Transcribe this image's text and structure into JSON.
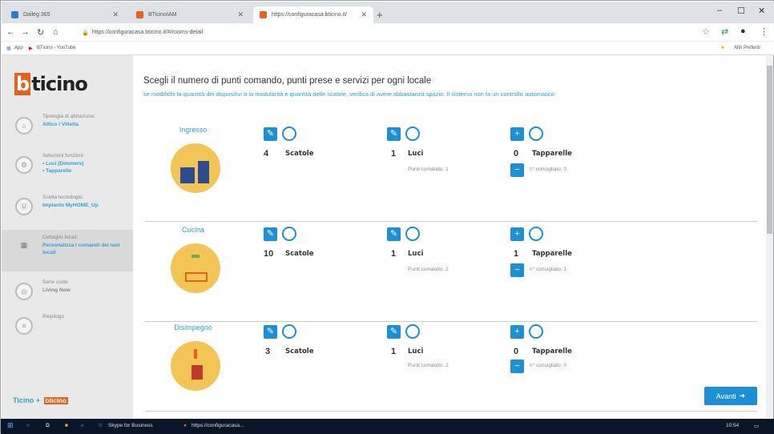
{
  "browser": {
    "tabs": [
      {
        "label": "Daileg 365",
        "color": "#2b7bd6"
      },
      {
        "label": "BTicinoIAM",
        "color": "#e8611a"
      },
      {
        "label": "https://configuracasa.bticino.it/",
        "color": "#e8611a"
      }
    ],
    "url": "https://configuracasa.bticino.it/#/rooms-detail",
    "bookmarks": [
      "App",
      "BTicino - YouTube"
    ],
    "other_bookmarks": "Altri Preferiti"
  },
  "sidebar": {
    "logo": "ticino",
    "steps": [
      {
        "t1": "Tipologia di abitazione:",
        "t2": "Attico / Villetta"
      },
      {
        "t1": "Selezioni funzioni:",
        "t2": "• Luci (Dimmers)\n• Tapparelle"
      },
      {
        "t1": "Scelta tecnologia:",
        "t2": "Impianto MyHOME_Up"
      },
      {
        "t1": "Dettaglio locali:",
        "t2": "Personalizza i comandi dei tuoi locali"
      },
      {
        "t1": "Serie civile:",
        "t2": "Living Now"
      },
      {
        "t1": "Riepilogo",
        "t2": ""
      }
    ],
    "footer": "Ticino + bticino"
  },
  "main": {
    "heading": "Scegli il numero di punti comando, punti prese e servizi per ogni locale",
    "sub": "se modifichi la quantità dei dispositivi o la modularità e quantità delle scatole, verifica di avere abbastanza spazio. Il sistema non fa un controllo automatico",
    "rooms": [
      {
        "name": "Ingresso",
        "scatole": "4",
        "luci": "1",
        "punti": "Punti comando: 1",
        "tapparelle": "0",
        "consigliato": "n° consigliato: 0"
      },
      {
        "name": "Cucina",
        "scatole": "10",
        "luci": "1",
        "punti": "Punti comando: 2",
        "tapparelle": "1",
        "consigliato": "n° consigliato: 1"
      },
      {
        "name": "Disimpegno",
        "scatole": "3",
        "luci": "1",
        "punti": "Punti comando: 2",
        "tapparelle": "0",
        "consigliato": "n° consigliato: 0"
      }
    ],
    "labels": {
      "scatole": "Scatole",
      "luci": "Luci",
      "tapparelle": "Tapparelle"
    },
    "next": "Avanti"
  },
  "taskbar": {
    "app1": "Skype for Business",
    "app2": "https://configuracasa...",
    "time": "10:54"
  }
}
